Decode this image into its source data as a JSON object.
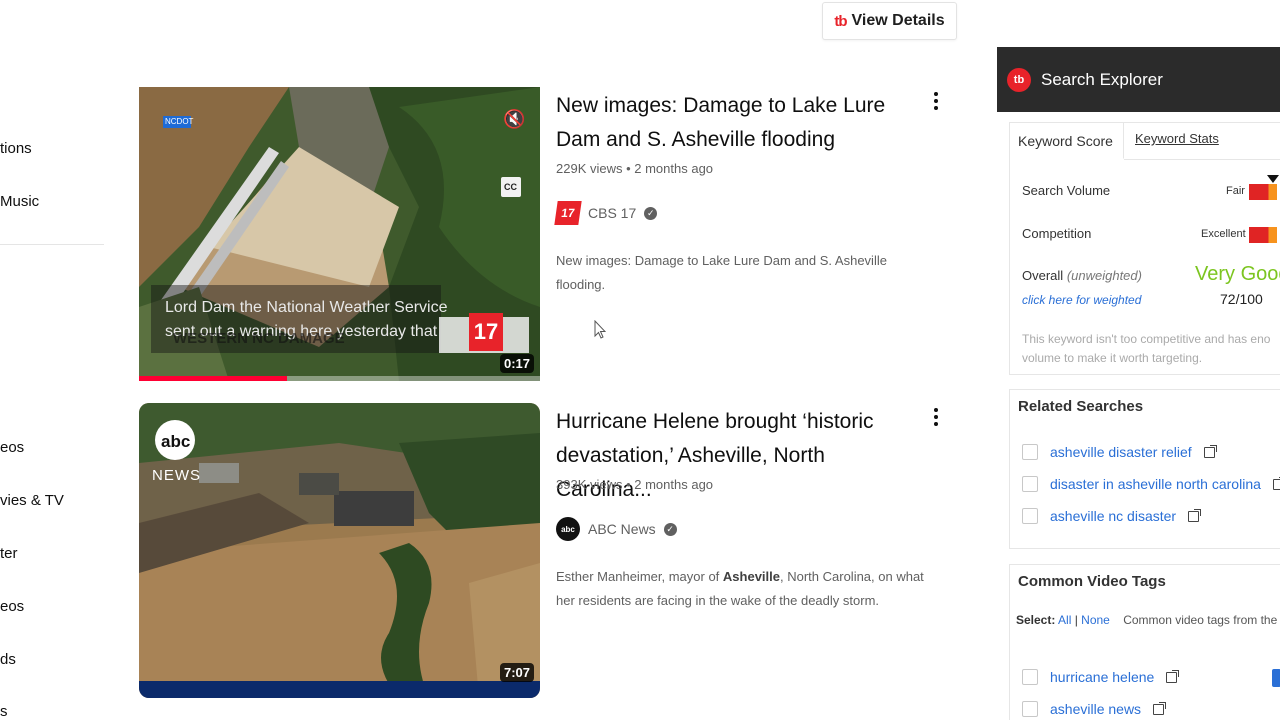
{
  "sidebar": {
    "items": [
      "tions",
      "Music",
      "eos",
      "vies & TV",
      "ter",
      "eos",
      "ds",
      "s"
    ]
  },
  "view_details": {
    "logo": "tb",
    "label": "View Details"
  },
  "videos": [
    {
      "title": "New images: Damage to Lake Lure Dam and S. Asheville flooding",
      "meta": "229K views • 2 months ago",
      "channel": "CBS 17",
      "description": "New images: Damage to Lake Lure Dam and S. Asheville flooding.",
      "duration": "0:17",
      "caption_line1": "Lord Dam the National Weather Service",
      "caption_line2": "sent out a warning here yesterday that",
      "lower_third": "WESTERN NC DAMAGE",
      "station_logo": "17",
      "badge": "NCDOT",
      "cc": "CC",
      "progress": 0.37
    },
    {
      "title": "Hurricane Helene brought ‘historic devastation,’ Asheville, North Carolina...",
      "meta": "393K views • 2 months ago",
      "channel": "ABC News",
      "description_pre": "Esther Manheimer, mayor of ",
      "description_bold": "Asheville",
      "description_post": ", North Carolina, on what her residents are facing in the wake of the deadly storm.",
      "duration": "7:07",
      "logo_text": "abc",
      "logo_sub": "NEWS"
    }
  ],
  "panel": {
    "logo": "tb",
    "title": "Search Explorer",
    "tabs": [
      "Keyword Score",
      "Keyword Stats"
    ],
    "search_volume_label": "Search Volume",
    "search_volume_value": "Fair",
    "competition_label": "Competition",
    "competition_value": "Excellent",
    "overall_label": "Overall",
    "overall_note": "(unweighted)",
    "weighted_link": "click here for weighted",
    "overall_rating": "Very Good",
    "overall_score": "72/100",
    "summary": "This keyword isn't too competitive and has eno volume to make it worth targeting.",
    "related_title": "Related Searches",
    "related": [
      "asheville disaster relief",
      "disaster in asheville north carolina",
      "asheville nc disaster"
    ],
    "tags_title": "Common Video Tags",
    "select_label": "Select:",
    "select_all": "All",
    "select_none": "None",
    "tags_note": "Common video tags from the to",
    "tags": [
      "hurricane helene",
      "asheville news"
    ]
  },
  "colors": {
    "accent": "#e8232a",
    "link": "#2a6fd6",
    "very_good": "#7cc520",
    "progress": "#ff0033"
  }
}
